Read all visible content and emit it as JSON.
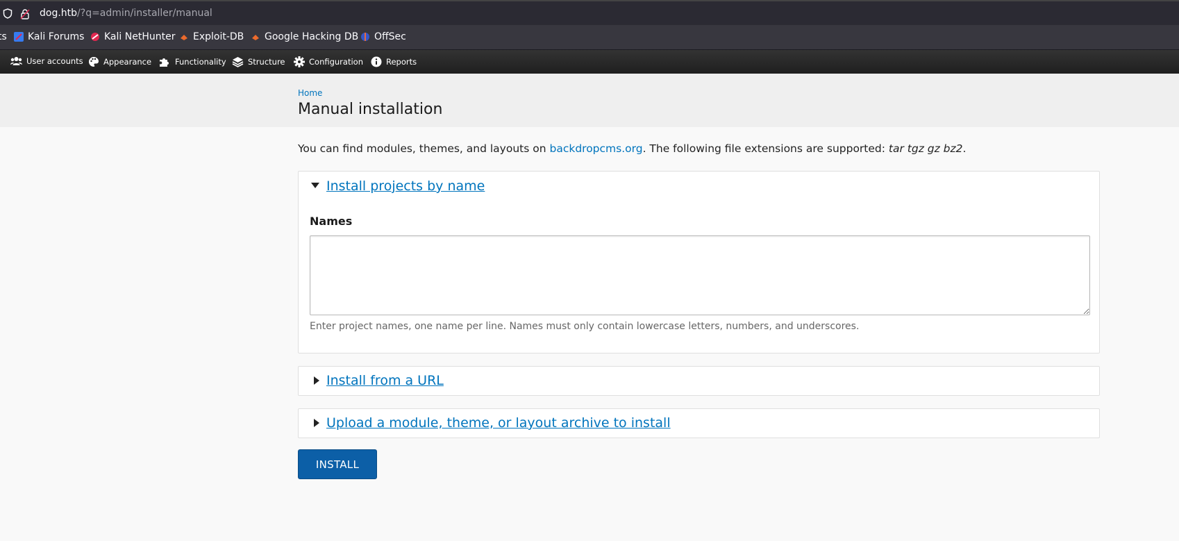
{
  "browser": {
    "url_host": "dog.htb",
    "url_path": "/?q=admin/installer/manual"
  },
  "bookmarks": [
    {
      "label": "ts",
      "icon": "truncated-bookmark"
    },
    {
      "label": "Kali Forums",
      "icon": "kali-forums-icon"
    },
    {
      "label": "Kali NetHunter",
      "icon": "kali-nethunter-icon"
    },
    {
      "label": "Exploit-DB",
      "icon": "exploit-db-icon"
    },
    {
      "label": "Google Hacking DB",
      "icon": "ghdb-icon"
    },
    {
      "label": "OffSec",
      "icon": "offsec-icon"
    }
  ],
  "admin_menu": [
    {
      "label": "User accounts",
      "icon": "users-icon"
    },
    {
      "label": "Appearance",
      "icon": "palette-icon"
    },
    {
      "label": "Functionality",
      "icon": "puzzle-icon"
    },
    {
      "label": "Structure",
      "icon": "layers-icon"
    },
    {
      "label": "Configuration",
      "icon": "gear-icon"
    },
    {
      "label": "Reports",
      "icon": "info-icon"
    }
  ],
  "breadcrumb": {
    "home": "Home"
  },
  "page": {
    "title": "Manual installation",
    "intro_before": "You can find modules, themes, and layouts on ",
    "intro_link": "backdropcms.org",
    "intro_middle": ". The following file extensions are supported: ",
    "intro_extensions": "tar tgz gz bz2",
    "intro_end": "."
  },
  "sections": {
    "by_name": {
      "legend": "Install projects by name",
      "expanded": true,
      "field_label": "Names",
      "field_value": "",
      "help": "Enter project names, one name per line. Names must only contain lowercase letters, numbers, and underscores."
    },
    "from_url": {
      "legend": "Install from a URL",
      "expanded": false
    },
    "upload": {
      "legend": "Upload a module, theme, or layout archive to install",
      "expanded": false
    }
  },
  "actions": {
    "install": "INSTALL"
  },
  "colors": {
    "link": "#0074bd",
    "button": "#0c5fa7",
    "admin_bar": "#262626"
  }
}
